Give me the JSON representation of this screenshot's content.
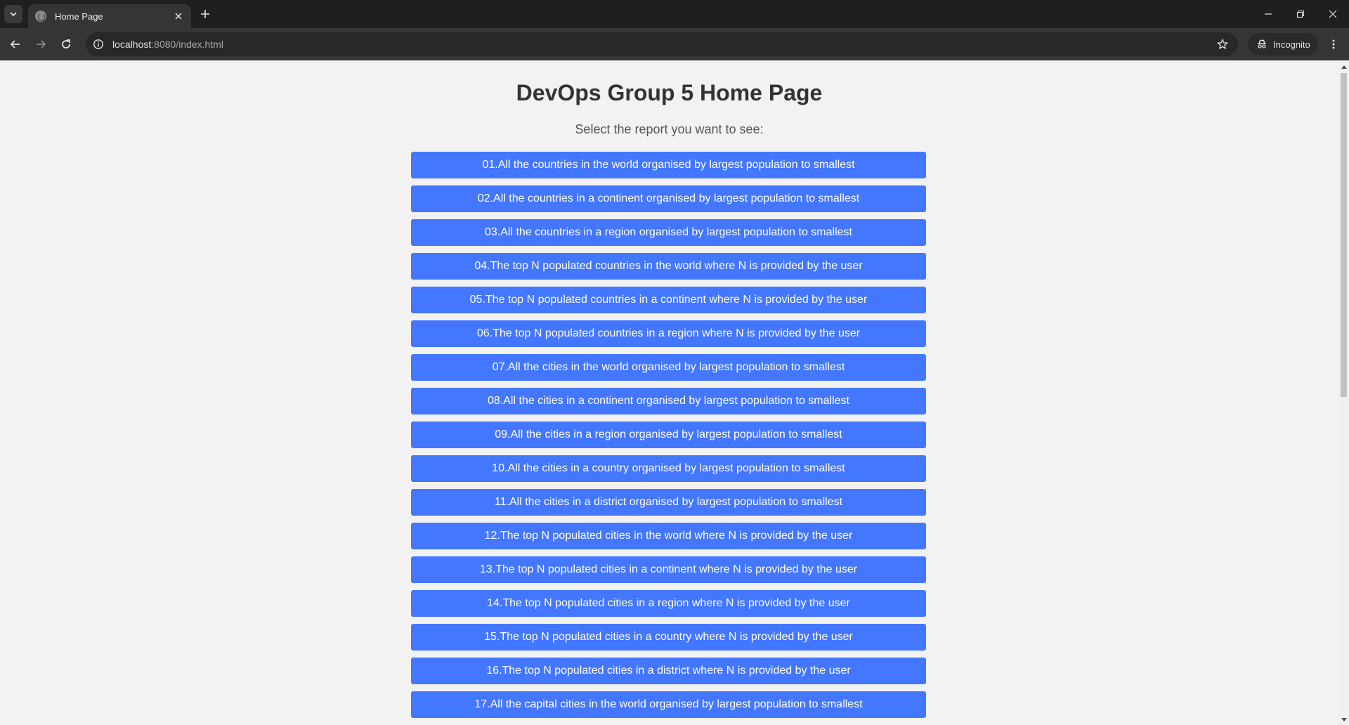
{
  "browser": {
    "tab_title": "Home Page",
    "url_host": "localhost",
    "url_path": ":8080/index.html",
    "profile_label": "Incognito"
  },
  "page": {
    "title": "DevOps Group 5 Home Page",
    "subtitle": "Select the report you want to see:",
    "reports": [
      "01.All the countries in the world organised by largest population to smallest",
      "02.All the countries in a continent organised by largest population to smallest",
      "03.All the countries in a region organised by largest population to smallest",
      "04.The top N populated countries in the world where N is provided by the user",
      "05.The top N populated countries in a continent where N is provided by the user",
      "06.The top N populated countries in a region where N is provided by the user",
      "07.All the cities in the world organised by largest population to smallest",
      "08.All the cities in a continent organised by largest population to smallest",
      "09.All the cities in a region organised by largest population to smallest",
      "10.All the cities in a country organised by largest population to smallest",
      "11.All the cities in a district organised by largest population to smallest",
      "12.The top N populated cities in the world where N is provided by the user",
      "13.The top N populated cities in a continent where N is provided by the user",
      "14.The top N populated cities in a region where N is provided by the user",
      "15.The top N populated cities in a country where N is provided by the user",
      "16.The top N populated cities in a district where N is provided by the user",
      "17.All the capital cities in the world organised by largest population to smallest"
    ]
  },
  "colors": {
    "button_bg": "#4477ff",
    "page_bg": "#f2f2f2",
    "chrome_dark": "#1f1f1f"
  }
}
